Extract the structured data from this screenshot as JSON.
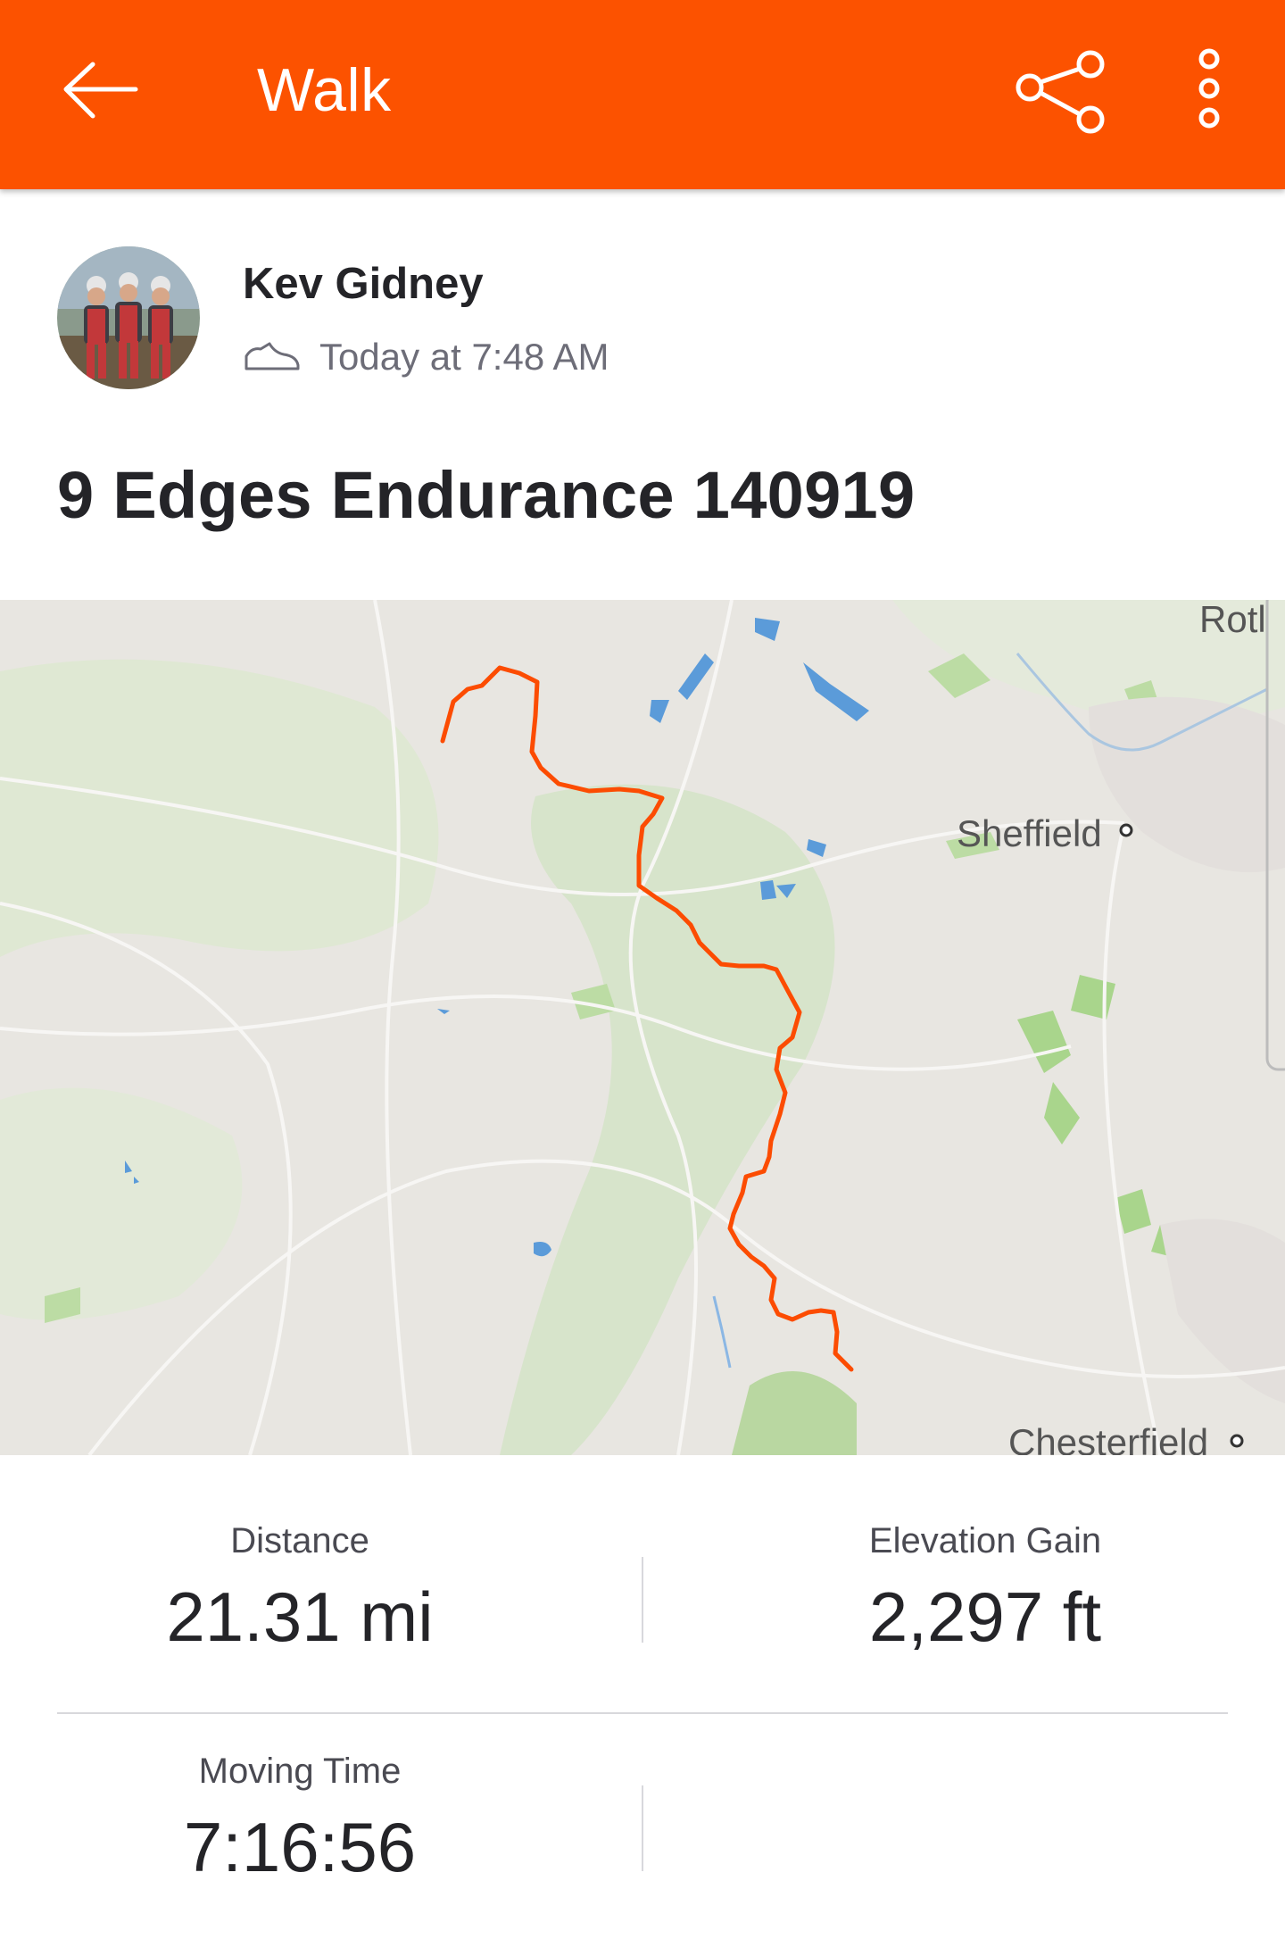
{
  "header": {
    "title": "Walk",
    "back_icon": "back-arrow-icon",
    "share_icon": "share-icon",
    "more_icon": "more-vert-icon",
    "accent_color": "#fc5200"
  },
  "athlete": {
    "name": "Kev Gidney",
    "timestamp": "Today at 7:48 AM",
    "activity_icon": "walking-shoe-icon"
  },
  "activity": {
    "title": "9 Edges Endurance 140919"
  },
  "map": {
    "route_color": "#fc4c02",
    "labels": {
      "sheffield": "Sheffield",
      "chesterfield": "Chesterfield",
      "rotherham_partial": "Rotl"
    }
  },
  "stats": [
    {
      "label": "Distance",
      "value": "21.31 mi"
    },
    {
      "label": "Elevation Gain",
      "value": "2,297 ft"
    },
    {
      "label": "Moving Time",
      "value": "7:16:56"
    }
  ]
}
